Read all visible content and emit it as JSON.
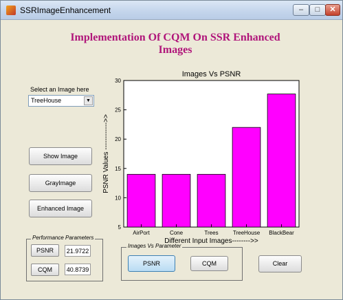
{
  "window": {
    "title": "SSRImageEnhancement",
    "minimize_glyph": "–",
    "maximize_glyph": "□",
    "close_glyph": "✕"
  },
  "heading": "Implementation Of CQM On SSR Enhanced Images",
  "image_selector": {
    "label": "Select an Image here",
    "selected": "TreeHouse",
    "arrow_glyph": "▼"
  },
  "buttons": {
    "show_image": "Show Image",
    "gray_image": "GrayImage",
    "enhanced_image": "Enhanced Image"
  },
  "performance": {
    "group_title": "Performance Parameters",
    "psnr_label": "PSNR",
    "psnr_value": "21.9722",
    "cqm_label": "CQM",
    "cqm_value": "40.8739"
  },
  "images_vs_parameter": {
    "group_title": "Images Vs Parameter",
    "psnr_button": "PSNR",
    "cqm_button": "CQM"
  },
  "clear_button": "Clear",
  "chart_data": {
    "type": "bar",
    "title": "Images Vs PSNR",
    "xlabel": "Different Input Images-------->>",
    "ylabel": "PSNR Values ------------>>",
    "categories": [
      "AirPort",
      "Cone",
      "Trees",
      "TreeHouse",
      "BlackBear"
    ],
    "values": [
      14,
      14,
      14,
      22,
      27.7
    ],
    "ylim": [
      5,
      30
    ],
    "yticks": [
      5,
      10,
      15,
      20,
      25,
      30
    ],
    "bar_color": "#ff00ff",
    "grid": false
  }
}
